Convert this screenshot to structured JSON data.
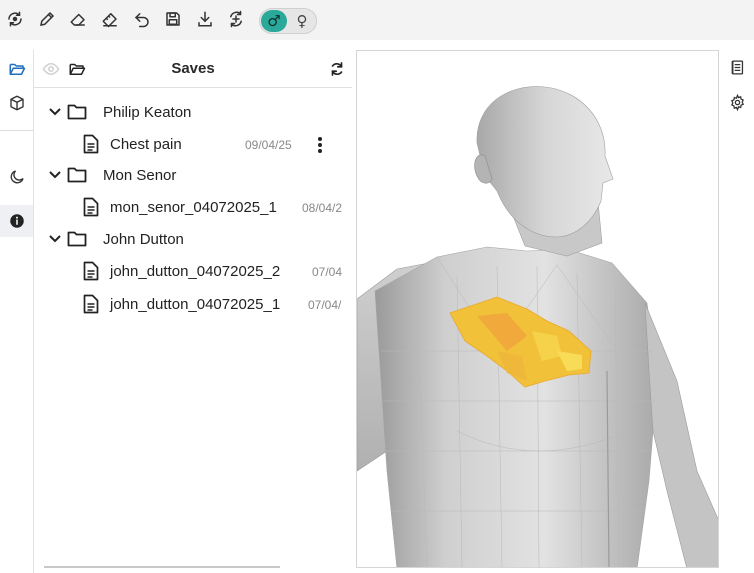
{
  "toolbar": {
    "tools": [
      "rotate-icon",
      "pen-icon",
      "eraser-icon",
      "ruler-eraser-icon",
      "undo-icon",
      "save-icon",
      "download-icon",
      "reset-view-icon"
    ],
    "gender_toggle": {
      "male_symbol": "♂",
      "female_symbol": "♀",
      "selected": "male"
    },
    "accent_color": "#2aa89a"
  },
  "left_rail": {
    "items": [
      "folder-open-icon",
      "cube-icon",
      "moon-icon",
      "info-icon"
    ],
    "active": "info-icon"
  },
  "saves_panel": {
    "title": "Saves",
    "groups": [
      {
        "name": "Philip Keaton",
        "files": [
          {
            "name": "Chest pain",
            "date": "09/04/25"
          }
        ]
      },
      {
        "name": "Mon Senor",
        "files": [
          {
            "name": "mon_senor_04072025_1",
            "date": "08/04/2"
          }
        ]
      },
      {
        "name": "John Dutton",
        "files": [
          {
            "name": "john_dutton_04072025_2",
            "date": "07/04"
          },
          {
            "name": "john_dutton_04072025_1",
            "date": "07/04/"
          }
        ]
      }
    ]
  },
  "viewer": {
    "highlight_color": "#f2c13a",
    "highlight_region": "upper left chest"
  },
  "right_rail": {
    "items": [
      "notes-icon",
      "settings-icon"
    ]
  }
}
